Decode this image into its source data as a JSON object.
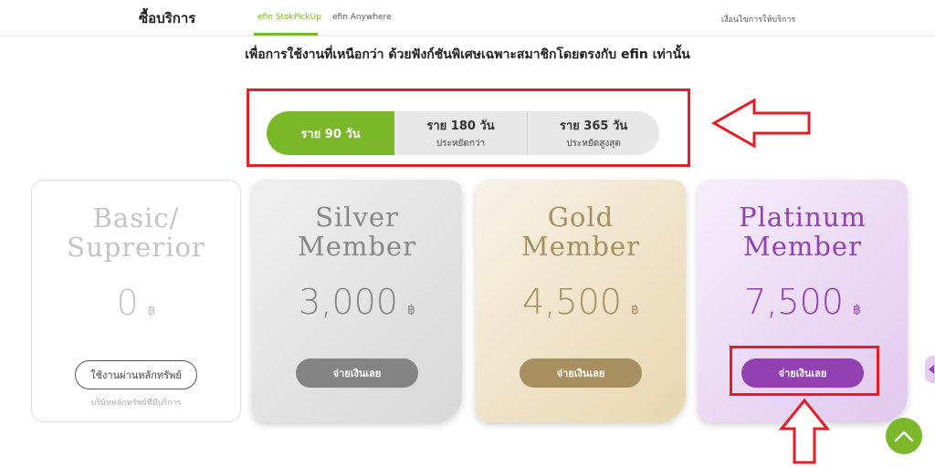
{
  "nav": {
    "brand": "ซื้อบริการ",
    "tabs": [
      {
        "label": "efin StokPickUp",
        "active": true
      },
      {
        "label": "efin Anywhere",
        "active": false
      }
    ],
    "terms_link": "เงื่อนไขการให้บริการ"
  },
  "headline": "เพื่อการใช้งานที่เหนือกว่า ด้วยฟังก์ชันพิเศษเฉพาะสมาชิกโดยตรงกับ efin เท่านั้น",
  "duration_toggle": {
    "selected_index": 0,
    "options": [
      {
        "label": "ราย 90 วัน",
        "sub": ""
      },
      {
        "label": "ราย 180 วัน",
        "sub": "ประหยัดกว่า"
      },
      {
        "label": "ราย 365 วัน",
        "sub": "ประหยัดสูงสุด"
      }
    ]
  },
  "plans": [
    {
      "title_line1": "Basic/",
      "title_line2": "Suprerior",
      "price": "0",
      "currency": "฿",
      "button": "ใช้งานผ่านหลักทรัพย์",
      "note": "บริษัทหลักทรัพย์ที่มีบริการ"
    },
    {
      "title_line1": "Silver",
      "title_line2": "Member",
      "price": "3,000",
      "currency": "฿",
      "button": "จ่ายเงินเลย"
    },
    {
      "title_line1": "Gold",
      "title_line2": "Member",
      "price": "4,500",
      "currency": "฿",
      "button": "จ่ายเงินเลย"
    },
    {
      "title_line1": "Platinum",
      "title_line2": "Member",
      "price": "7,500",
      "currency": "฿",
      "button": "จ่ายเงินเลย"
    }
  ],
  "colors": {
    "accent_green": "#7ab829",
    "annotation_red": "#e01f26",
    "silver": "#848484",
    "gold": "#a88f5f",
    "platinum": "#9340b3"
  },
  "icons": {
    "scroll_top": "chevron-up-icon",
    "side_tab": "chevron-left-icon"
  }
}
